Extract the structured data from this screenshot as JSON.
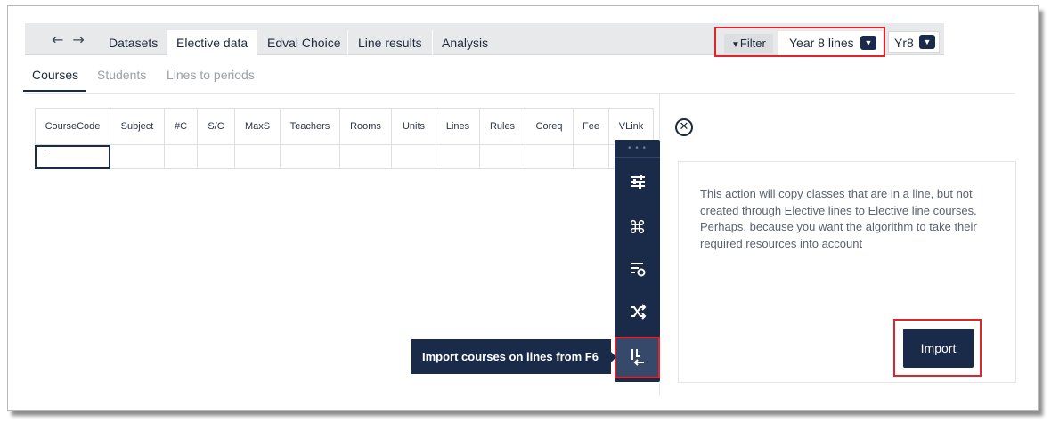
{
  "nav": {
    "back_icon": "←",
    "forward_icon": "→"
  },
  "tabs": [
    {
      "label": "Datasets",
      "active": false
    },
    {
      "label": "Elective data",
      "active": true
    },
    {
      "label": "Edval Choice",
      "active": false
    },
    {
      "label": "Line results",
      "active": false
    },
    {
      "label": "Analysis",
      "active": false
    }
  ],
  "filter": {
    "label": "Filter",
    "selected": "Year 8 lines",
    "year": "Yr8"
  },
  "subtabs": [
    {
      "label": "Courses",
      "active": true
    },
    {
      "label": "Students",
      "active": false
    },
    {
      "label": "Lines to periods",
      "active": false
    }
  ],
  "grid": {
    "columns": [
      "CourseCode",
      "Subject",
      "#C",
      "S/C",
      "MaxS",
      "Teachers",
      "Rooms",
      "Units",
      "Lines",
      "Rules",
      "Coreq",
      "Fee",
      "VLink"
    ]
  },
  "toolbar": {
    "icons": [
      "sliders-icon",
      "command-icon",
      "sort-refresh-icon",
      "shuffle-icon",
      "import-lines-icon"
    ],
    "tooltip": "Import courses on lines from F6"
  },
  "panel": {
    "description": "This action will copy classes that are in a line, but not created through Elective lines to Elective line courses. Perhaps, because you want the algorithm to take their required resources into account",
    "import_label": "Import"
  },
  "colors": {
    "accent": "#1a2b4a",
    "highlight": "#e0242b"
  }
}
